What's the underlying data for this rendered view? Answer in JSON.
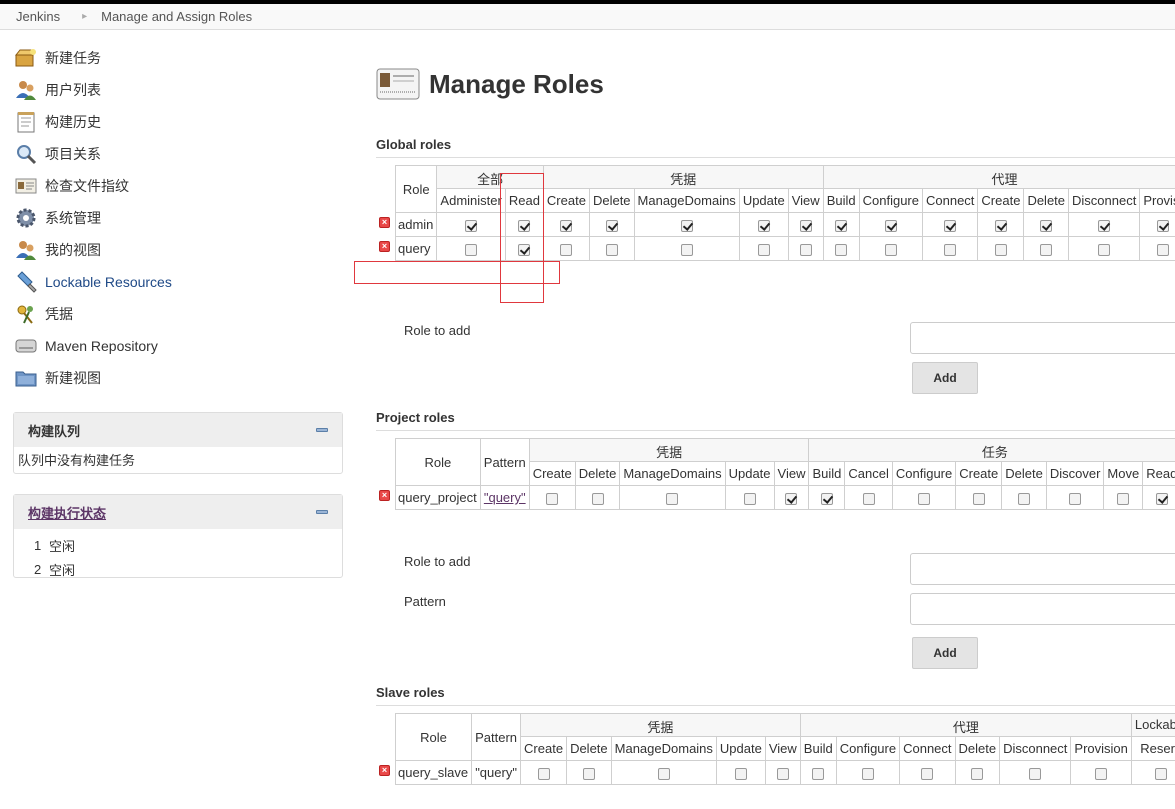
{
  "breadcrumb": {
    "root": "Jenkins",
    "current": "Manage and Assign Roles"
  },
  "sidebar": {
    "tasks": [
      {
        "label": "新建任务",
        "icon": "new-item-icon"
      },
      {
        "label": "用户列表",
        "icon": "users-icon"
      },
      {
        "label": "构建历史",
        "icon": "notepad-icon"
      },
      {
        "label": "项目关系",
        "icon": "search-icon"
      },
      {
        "label": "检查文件指纹",
        "icon": "fingerprint-icon"
      },
      {
        "label": "系统管理",
        "icon": "gear-icon"
      },
      {
        "label": "我的视图",
        "icon": "user-icon"
      },
      {
        "label": "Lockable Resources",
        "icon": "usb-icon"
      },
      {
        "label": "凭据",
        "icon": "keys-icon"
      },
      {
        "label": "Maven Repository",
        "icon": "drive-icon"
      },
      {
        "label": "新建视图",
        "icon": "folder-icon"
      }
    ],
    "build_queue": {
      "title": "构建队列",
      "empty": "队列中没有构建任务"
    },
    "executors": {
      "title": "构建执行状态",
      "rows": [
        {
          "num": "1",
          "state": "空闲"
        },
        {
          "num": "2",
          "state": "空闲"
        }
      ]
    }
  },
  "main": {
    "title": "Manage Roles",
    "global": {
      "heading": "Global roles",
      "role_col": "Role",
      "groups": [
        "全部",
        "凭据",
        "代理"
      ],
      "perms": [
        "Administer",
        "Read",
        "Create",
        "Delete",
        "ManageDomains",
        "Update",
        "View",
        "Build",
        "Configure",
        "Connect",
        "Create",
        "Delete",
        "Disconnect",
        "Provisi"
      ],
      "rows": [
        {
          "name": "admin",
          "checks": [
            true,
            true,
            true,
            true,
            true,
            true,
            true,
            true,
            true,
            true,
            true,
            true,
            true,
            true
          ]
        },
        {
          "name": "query",
          "checks": [
            false,
            true,
            false,
            false,
            false,
            false,
            false,
            false,
            false,
            false,
            false,
            false,
            false,
            false
          ]
        }
      ],
      "role_to_add": "Role to add",
      "add": "Add"
    },
    "project": {
      "heading": "Project roles",
      "role_col": "Role",
      "pattern_col": "Pattern",
      "groups": [
        "凭据",
        "任务"
      ],
      "perms": [
        "Create",
        "Delete",
        "ManageDomains",
        "Update",
        "View",
        "Build",
        "Cancel",
        "Configure",
        "Create",
        "Delete",
        "Discover",
        "Move",
        "Read"
      ],
      "rows": [
        {
          "name": "query_project",
          "pattern": "\"query\"",
          "checks": [
            false,
            false,
            false,
            false,
            true,
            true,
            false,
            false,
            false,
            false,
            false,
            false,
            true
          ]
        }
      ],
      "role_to_add": "Role to add",
      "pattern": "Pattern",
      "add": "Add"
    },
    "slave": {
      "heading": "Slave roles",
      "role_col": "Role",
      "pattern_col": "Pattern",
      "groups": [
        "凭据",
        "代理",
        "Lockable"
      ],
      "perms": [
        "Create",
        "Delete",
        "ManageDomains",
        "Update",
        "View",
        "Build",
        "Configure",
        "Connect",
        "Delete",
        "Disconnect",
        "Provision",
        "Reserv"
      ],
      "rows": [
        {
          "name": "query_slave",
          "pattern": "\"query\"",
          "checks": [
            false,
            false,
            false,
            false,
            false,
            false,
            false,
            false,
            false,
            false,
            false,
            false
          ]
        }
      ]
    }
  }
}
